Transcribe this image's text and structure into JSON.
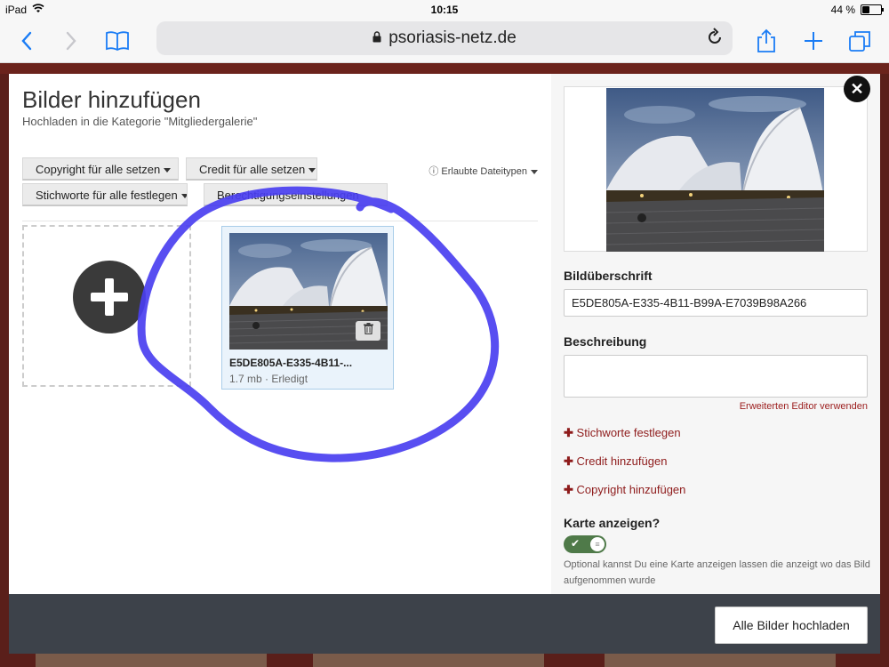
{
  "status": {
    "device": "iPad",
    "time": "10:15",
    "battery": "44 %",
    "battery_fraction": 0.44
  },
  "browser": {
    "url": "psoriasis-netz.de"
  },
  "modal": {
    "title": "Bilder hinzufügen",
    "subtitle": "Hochladen in die Kategorie \"Mitgliedergalerie\"",
    "buttons": {
      "copyright": "Copyright für alle setzen",
      "credit": "Credit für alle setzen",
      "keywords": "Stichworte für alle festlegen",
      "permissions": "Berechtigungseinstellungen"
    },
    "filetypes": "Erlaubte Dateitypen",
    "file": {
      "name": "E5DE805A-E335-4B11-...",
      "meta": "1.7 mb · Erledigt"
    }
  },
  "panel": {
    "caption_label": "Bildüberschrift",
    "caption_value": "E5DE805A-E335-4B11-B99A-E7039B98A266",
    "description_label": "Beschreibung",
    "editor_link": "Erweiterten Editor verwenden",
    "add_keywords": "Stichworte festlegen",
    "add_credit": "Credit hinzufügen",
    "add_copyright": "Copyright hinzufügen",
    "map_label": "Karte anzeigen?",
    "map_enabled": true,
    "map_hint": "Optional kannst Du eine Karte anzeigen lassen die anzeigt wo das Bild aufgenommen wurde"
  },
  "footer": {
    "upload_all": "Alle Bilder hochladen"
  },
  "colors": {
    "link": "#8e1b1b",
    "toggle_on": "#4f7a49",
    "footer": "#3d424a",
    "scribble": "#4a3ff0"
  }
}
